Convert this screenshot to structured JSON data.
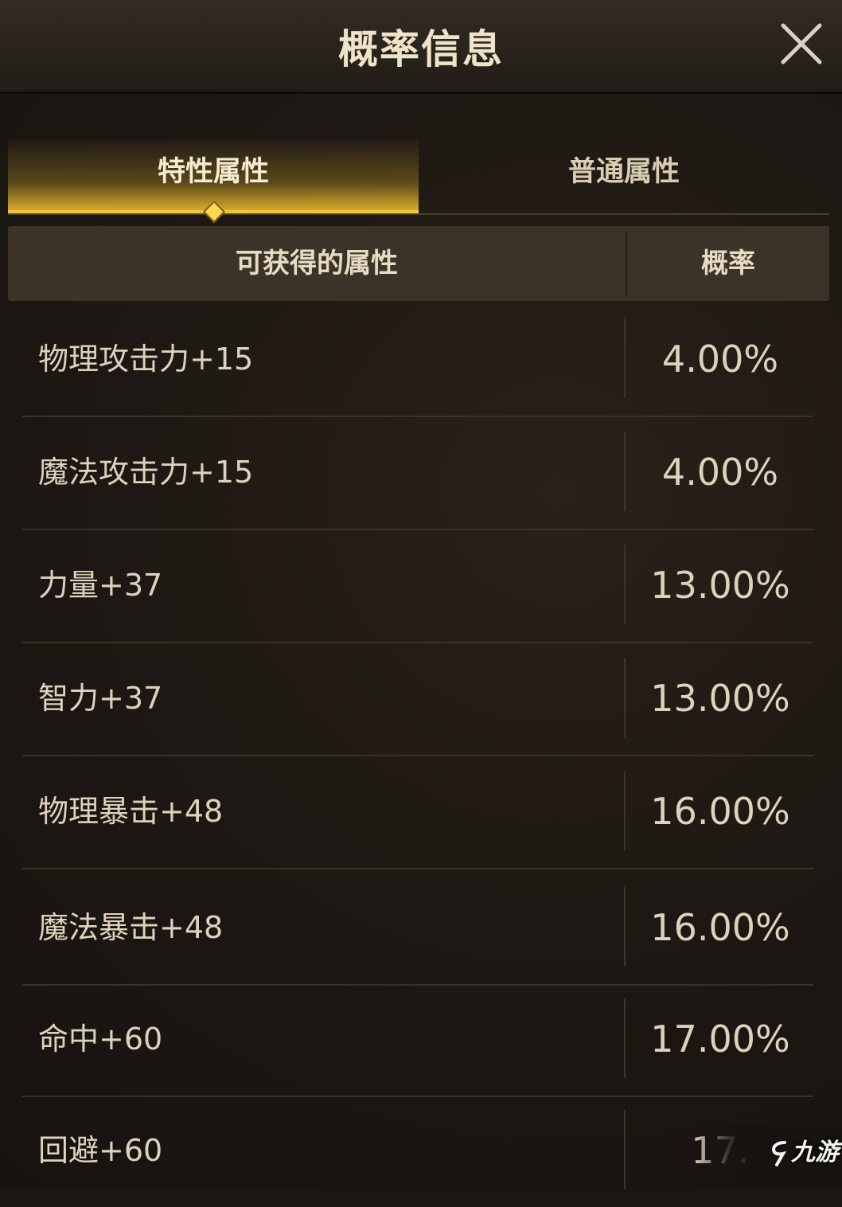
{
  "header": {
    "title": "概率信息",
    "close_icon": "close-icon"
  },
  "tabs": [
    {
      "label": "特性属性",
      "active": true
    },
    {
      "label": "普通属性",
      "active": false
    }
  ],
  "table": {
    "columns": [
      "可获得的属性",
      "概率"
    ],
    "rows": [
      {
        "attribute": "物理攻击力+15",
        "probability": "4.00%"
      },
      {
        "attribute": "魔法攻击力+15",
        "probability": "4.00%"
      },
      {
        "attribute": "力量+37",
        "probability": "13.00%"
      },
      {
        "attribute": "智力+37",
        "probability": "13.00%"
      },
      {
        "attribute": "物理暴击+48",
        "probability": "16.00%"
      },
      {
        "attribute": "魔法暴击+48",
        "probability": "16.00%"
      },
      {
        "attribute": "命中+60",
        "probability": "17.00%"
      },
      {
        "attribute": "回避+60",
        "probability": "17."
      }
    ]
  },
  "watermark": {
    "text": "九游"
  },
  "colors": {
    "accent_gold": "#f2c540",
    "text_light": "#ddd2bc",
    "background": "#1b1612"
  }
}
